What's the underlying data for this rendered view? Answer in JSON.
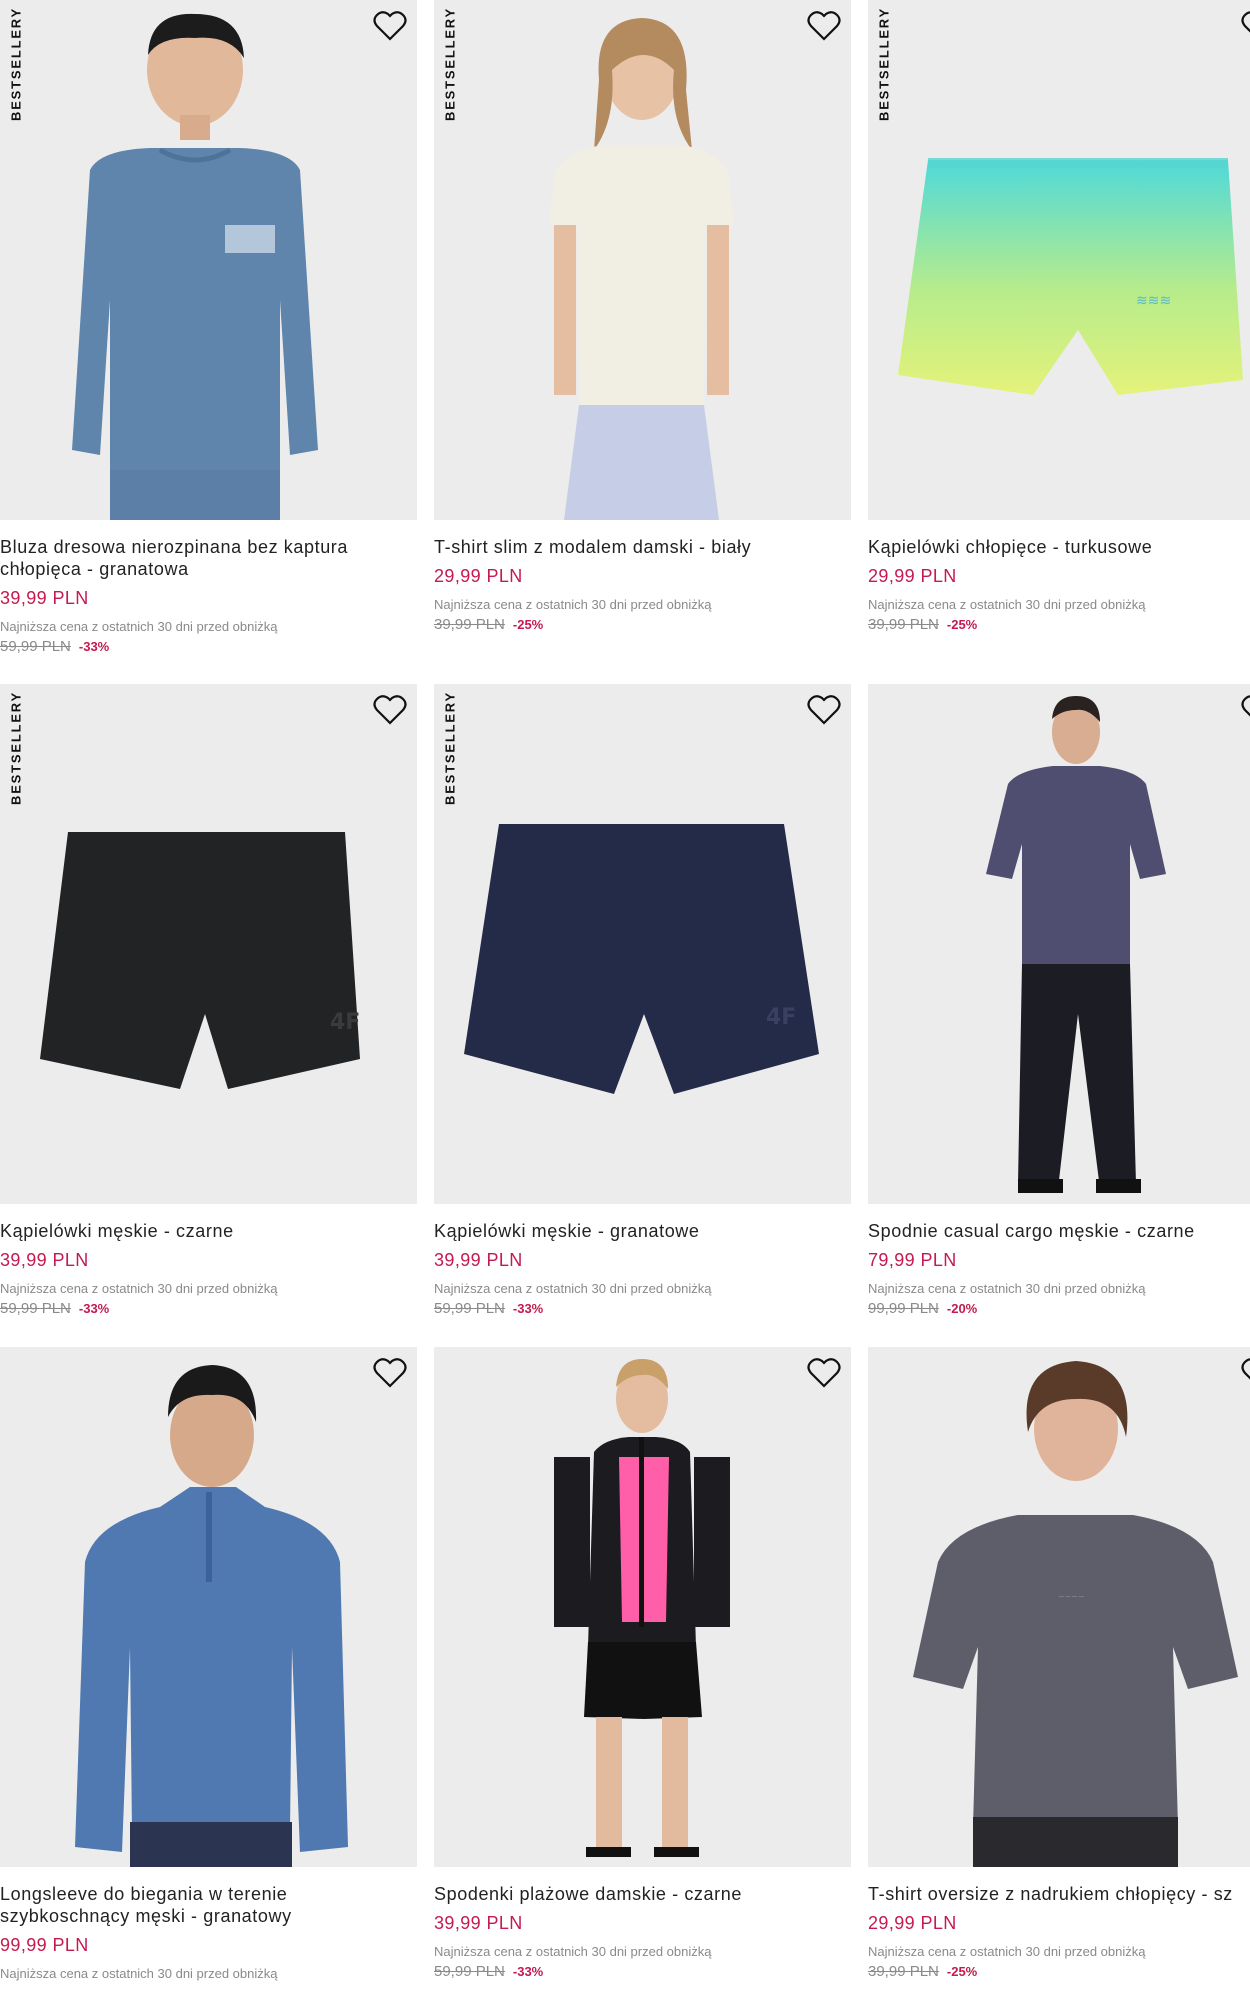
{
  "badge_label": "BESTSELLERY",
  "lowest_label": "Najniższa cena z ostatnich 30 dni przed obniżką",
  "colors": {
    "price": "#c41a4f",
    "card_bg": "#ececec"
  },
  "products": [
    {
      "name": "Bluza dresowa nierozpinana bez kaptura chłopięca - granatowa",
      "price": "39,99 PLN",
      "old_price": "59,99 PLN",
      "discount": "-33%",
      "bestseller": true,
      "icon": "heart-icon"
    },
    {
      "name": "T-shirt slim z modalem damski - biały",
      "price": "29,99 PLN",
      "old_price": "39,99 PLN",
      "discount": "-25%",
      "bestseller": true,
      "icon": "heart-icon"
    },
    {
      "name": "Kąpielówki chłopięce - turkusowe",
      "price": "29,99 PLN",
      "old_price": "39,99 PLN",
      "discount": "-25%",
      "bestseller": true,
      "icon": "heart-icon"
    },
    {
      "name": "Kąpielówki męskie - czarne",
      "price": "39,99 PLN",
      "old_price": "59,99 PLN",
      "discount": "-33%",
      "bestseller": true,
      "icon": "heart-icon"
    },
    {
      "name": "Kąpielówki męskie - granatowe",
      "price": "39,99 PLN",
      "old_price": "59,99 PLN",
      "discount": "-33%",
      "bestseller": true,
      "icon": "heart-icon"
    },
    {
      "name": "Spodnie casual cargo męskie - czarne",
      "price": "79,99 PLN",
      "old_price": "99,99 PLN",
      "discount": "-20%",
      "bestseller": false,
      "icon": "heart-icon"
    },
    {
      "name": "Longsleeve do biegania w terenie szybkoschnący męski - granatowy",
      "price": "99,99 PLN",
      "old_price": "",
      "discount": "",
      "bestseller": false,
      "icon": "heart-icon"
    },
    {
      "name": "Spodenki plażowe damskie - czarne",
      "price": "39,99 PLN",
      "old_price": "59,99 PLN",
      "discount": "-33%",
      "bestseller": false,
      "icon": "heart-icon"
    },
    {
      "name": "T-shirt oversize z nadrukiem chłopięcy - sz",
      "price": "29,99 PLN",
      "old_price": "39,99 PLN",
      "discount": "-25%",
      "bestseller": false,
      "icon": "heart-icon"
    }
  ]
}
